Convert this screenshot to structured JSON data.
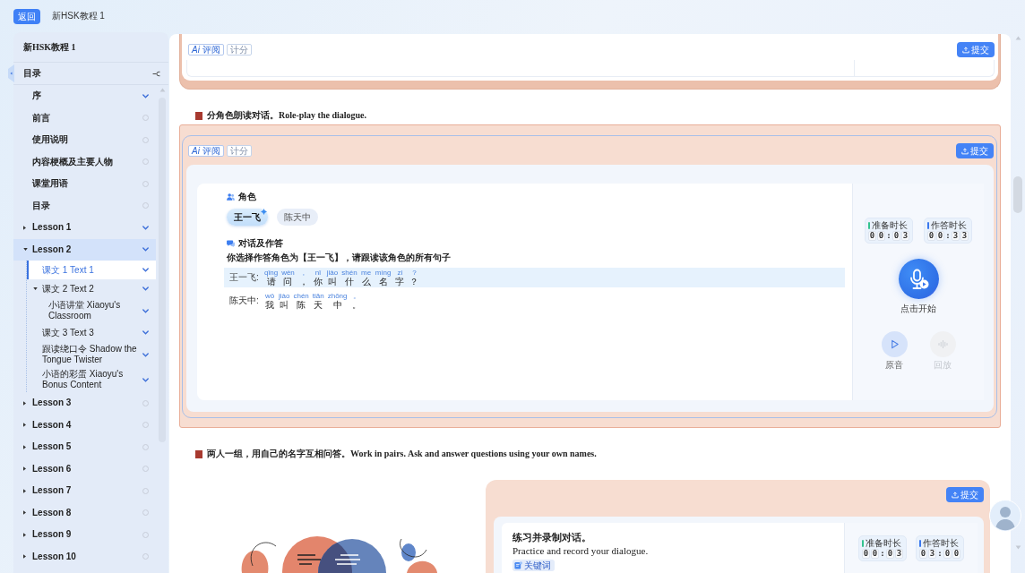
{
  "top_bar": {
    "back_button": "返回",
    "title": "新HSK教程 1"
  },
  "sidebar": {
    "title": "新HSK教程 1",
    "toc_label": "目录",
    "items": [
      {
        "kind": "page",
        "label": "序",
        "active": true,
        "selected": false
      },
      {
        "kind": "page",
        "label": "前言",
        "active": false,
        "selected": false
      },
      {
        "kind": "page",
        "label": "使用说明",
        "active": false,
        "selected": false
      },
      {
        "kind": "page",
        "label": "内容梗概及主要人物",
        "active": false,
        "selected": false
      },
      {
        "kind": "page",
        "label": "课堂用语",
        "active": false,
        "selected": false
      },
      {
        "kind": "page",
        "label": "目录",
        "active": false,
        "selected": false
      },
      {
        "kind": "folder",
        "label": "Lesson 1",
        "expanded": false,
        "active": true,
        "selected": false
      },
      {
        "kind": "folder",
        "label": "Lesson 2",
        "expanded": true,
        "active": true,
        "selected": false,
        "children": [
          {
            "kind": "page",
            "label": "课文 1 Text 1",
            "active": true,
            "selected": true
          },
          {
            "kind": "folder",
            "label": "课文 2 Text 2",
            "expanded": true,
            "active": true,
            "selected": false,
            "children": [
              {
                "kind": "page",
                "label": "小语讲堂 Xiaoyu's Classroom",
                "active": true,
                "selected": false
              }
            ]
          },
          {
            "kind": "page",
            "label": "课文 3 Text 3",
            "active": true,
            "selected": false
          },
          {
            "kind": "page",
            "label": "跟读绕口令 Shadow the Tongue Twister",
            "active": true,
            "selected": false
          },
          {
            "kind": "page",
            "label": "小语的彩蛋 Xiaoyu's Bonus Content",
            "active": true,
            "selected": false
          }
        ]
      },
      {
        "kind": "folder",
        "label": "Lesson 3",
        "expanded": false,
        "active": false,
        "selected": false
      },
      {
        "kind": "folder",
        "label": "Lesson 4",
        "expanded": false,
        "active": false,
        "selected": false
      },
      {
        "kind": "folder",
        "label": "Lesson 5",
        "expanded": false,
        "active": false,
        "selected": false
      },
      {
        "kind": "folder",
        "label": "Lesson 6",
        "expanded": false,
        "active": false,
        "selected": false
      },
      {
        "kind": "folder",
        "label": "Lesson 7",
        "expanded": false,
        "active": false,
        "selected": false
      },
      {
        "kind": "folder",
        "label": "Lesson 8",
        "expanded": false,
        "active": false,
        "selected": false
      },
      {
        "kind": "folder",
        "label": "Lesson 9",
        "expanded": false,
        "active": false,
        "selected": false
      },
      {
        "kind": "folder",
        "label": "Lesson 10",
        "expanded": false,
        "active": false,
        "selected": false
      }
    ]
  },
  "main": {
    "sections": [
      {
        "kind": "activity",
        "tags": [
          {
            "kind": "ai",
            "text": "*Ai* 评阅"
          },
          {
            "kind": "score",
            "text": "计分"
          }
        ],
        "submit_button": "提交"
      },
      {
        "kind": "heading",
        "text": "分角色朗读对话。Role-play the dialogue."
      },
      {
        "kind": "roleplay",
        "tags": [
          {
            "kind": "ai",
            "text": "*Ai* 评阅"
          },
          {
            "kind": "score",
            "text": "计分"
          }
        ],
        "submit_button": "提交",
        "roles_label": "角色",
        "roles": [
          {
            "name": "王一飞",
            "selected": true
          },
          {
            "name": "陈天中",
            "selected": false
          }
        ],
        "dialogue_label": "对话及作答",
        "instruction": "你选择作答角色为【王一飞】，请跟读该角色的所有句子",
        "lines": [
          {
            "speaker": "王一飞:",
            "highlighted": true,
            "tokens": [
              {
                "pinyin": "qǐng",
                "hanzi": "请"
              },
              {
                "pinyin": "wèn",
                "hanzi": "问"
              },
              {
                "pinyin": ",",
                "hanzi": "，"
              },
              {
                "pinyin": "nǐ",
                "hanzi": "你"
              },
              {
                "pinyin": "jiào",
                "hanzi": "叫"
              },
              {
                "pinyin": "shén",
                "hanzi": "什"
              },
              {
                "pinyin": "me",
                "hanzi": "么"
              },
              {
                "pinyin": "míng",
                "hanzi": "名"
              },
              {
                "pinyin": "zi",
                "hanzi": "字"
              },
              {
                "pinyin": "?",
                "hanzi": "？"
              }
            ]
          },
          {
            "speaker": "陈天中:",
            "highlighted": false,
            "tokens": [
              {
                "pinyin": "wǒ",
                "hanzi": "我"
              },
              {
                "pinyin": "jiào",
                "hanzi": "叫"
              },
              {
                "pinyin": "chén",
                "hanzi": "陈"
              },
              {
                "pinyin": "tiān",
                "hanzi": "天"
              },
              {
                "pinyin": "zhōng",
                "hanzi": "中"
              },
              {
                "pinyin": "。",
                "hanzi": "。"
              }
            ]
          }
        ],
        "timers": [
          {
            "label": "准备时长",
            "color": "#34c38f",
            "minutes": [
              "0",
              "0"
            ],
            "separator": ":",
            "seconds": [
              "0",
              "3"
            ]
          },
          {
            "label": "作答时长",
            "color": "#3a78ee",
            "minutes": [
              "0",
              "0"
            ],
            "separator": ":",
            "seconds": [
              "3",
              "3"
            ]
          }
        ],
        "record_button": {
          "label": "点击开始"
        },
        "audio_buttons": [
          {
            "kind": "play",
            "label": "原音",
            "disabled": false
          },
          {
            "kind": "waveform",
            "label": "回放",
            "disabled": true
          }
        ]
      },
      {
        "kind": "heading",
        "text": "两人一组，用自己的名字互相问答。Work in pairs. Ask and answer questions using your own names."
      },
      {
        "kind": "pair_practice",
        "submit_button": "提交",
        "prompt_title": "练习并录制对话。",
        "prompt_text": "Practice and record your dialogue.",
        "keyword_tag": "关键词",
        "timers": [
          {
            "label": "准备时长",
            "color": "#34c38f",
            "minutes": [
              "0",
              "0"
            ],
            "separator": ":",
            "seconds": [
              "0",
              "3"
            ]
          },
          {
            "label": "作答时长",
            "color": "#3a78ee",
            "minutes": [
              "0",
              "3"
            ],
            "separator": ":",
            "seconds": [
              "0",
              "0"
            ]
          }
        ]
      }
    ]
  }
}
